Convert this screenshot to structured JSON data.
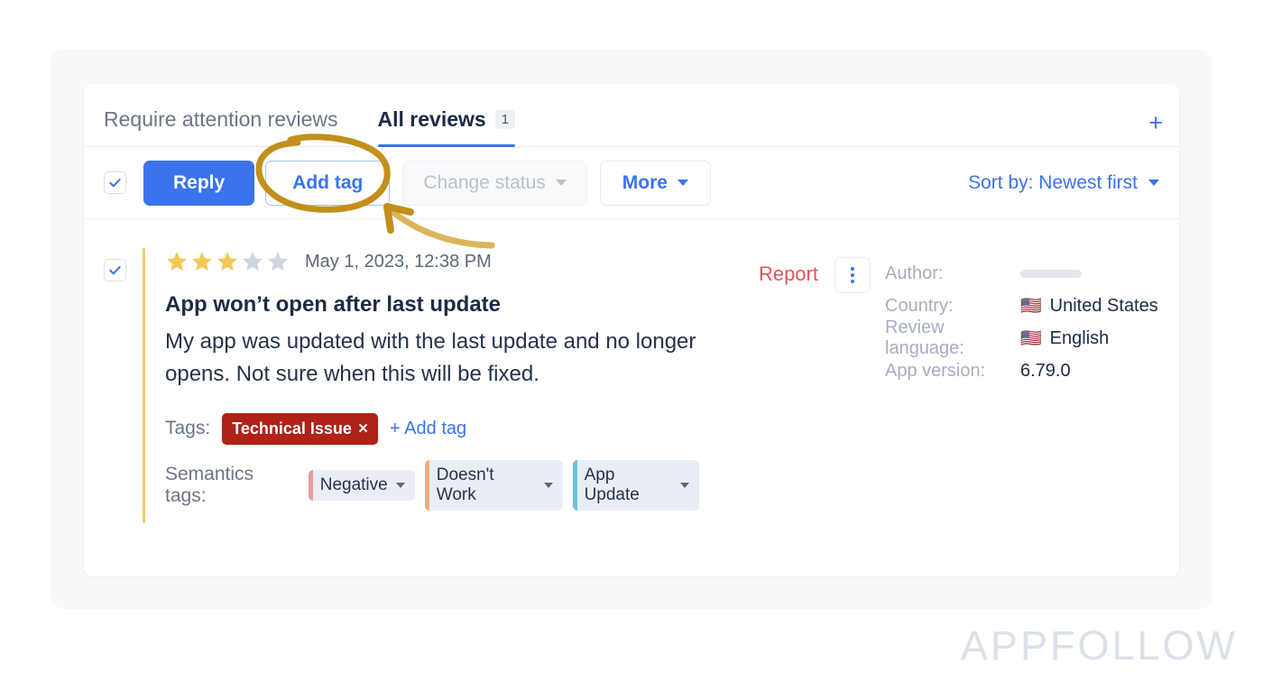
{
  "tabs": {
    "require_attention": "Require attention reviews",
    "all_reviews": "All reviews",
    "all_reviews_count": "1",
    "add_tab_icon": "plus-icon"
  },
  "toolbar": {
    "select_all_checkbox": "checkmark-icon",
    "reply_label": "Reply",
    "add_tag_label": "Add tag",
    "change_status_label": "Change status",
    "more_label": "More",
    "sort_label": "Sort by: Newest first"
  },
  "review": {
    "rating": 3,
    "max_rating": 5,
    "date": "May 1, 2023, 12:38 PM",
    "title": "App won’t open after last update",
    "body": "My app was updated with the last update and no longer opens. Not sure when this will be fixed.",
    "report_label": "Report",
    "kebab_icon": "more-vertical-icon",
    "tags_label": "Tags:",
    "tags": [
      {
        "label": "Technical Issue",
        "remove": "×",
        "color": "#ae2218"
      }
    ],
    "add_tag_link": "+ Add tag",
    "semantics_label": "Semantics tags:",
    "semantic_tags": [
      {
        "label": "Negative",
        "color": "#ef9a9a"
      },
      {
        "label": "Doesn't Work",
        "color": "#f2ab80"
      },
      {
        "label": "App Update",
        "color": "#6ec1de"
      }
    ]
  },
  "meta": {
    "rows": [
      {
        "key": "Author:",
        "value": "",
        "flag": "",
        "redacted": true
      },
      {
        "key": "Country:",
        "value": "United States",
        "flag": "🇺🇸",
        "redacted": false
      },
      {
        "key": "Review language:",
        "value": "English",
        "flag": "🇺🇸",
        "redacted": false
      },
      {
        "key": "App version:",
        "value": "6.79.0",
        "flag": "",
        "redacted": false
      }
    ]
  },
  "annotation": {
    "type": "hand-drawn-ellipse-with-arrow",
    "target": "Add tag",
    "color": "#c2901a"
  },
  "watermark": "APPFOLLOW",
  "colors": {
    "accent_blue": "#3b73ed",
    "star_gold": "#f3c955",
    "star_grey": "#ced4e0",
    "report_red": "#e2545a",
    "tag_red": "#ae2218",
    "annotation_gold": "#c2901a",
    "review_accent": "#f0cf63"
  }
}
